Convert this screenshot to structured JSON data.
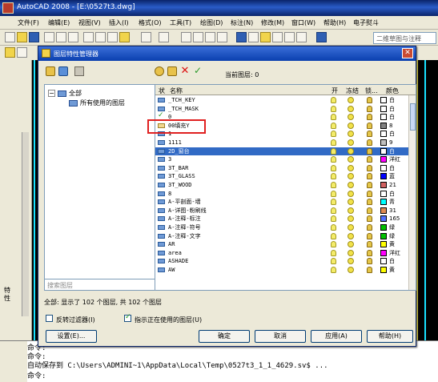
{
  "app": {
    "title": "AutoCAD 2008 - [E:\\0527t3.dwg]"
  },
  "menu": [
    "文件(F)",
    "编辑(E)",
    "视图(V)",
    "插入(I)",
    "格式(O)",
    "工具(T)",
    "绘图(D)",
    "标注(N)",
    "修改(M)",
    "窗口(W)",
    "帮助(H)",
    "电子熨斗"
  ],
  "workspace": {
    "value": "二维草图与注释"
  },
  "left_panel": {
    "vertical_tab": "特性"
  },
  "dialog": {
    "title": "图层特性管理器",
    "close_glyph": "✕",
    "current_layer": "当前图层: 0",
    "tree": {
      "all": "全部",
      "unused": "所有使用的图层"
    },
    "search_placeholder": "搜索图层",
    "columns": {
      "status": "状",
      "name": "名称",
      "on": "开",
      "freeze": "冻结",
      "lock": "锁...",
      "color": "颜色"
    },
    "status_text": "全部: 显示了 102 个图层, 共 102 个图层",
    "invert_filter": "反转过滤器(I)",
    "show_in_use": "指示正在使用的图层(U)",
    "buttons": {
      "settings": "设置(E)...",
      "ok": "确定",
      "cancel": "取消",
      "apply": "应用(A)",
      "help": "帮助(H)"
    }
  },
  "layers": [
    {
      "name": "_TCH_KEY",
      "color_name": "白",
      "color": "#ffffff",
      "state": "normal"
    },
    {
      "name": "_TCH_MASK",
      "color_name": "白",
      "color": "#ffffff",
      "state": "normal"
    },
    {
      "name": "0",
      "color_name": "白",
      "color": "#ffffff",
      "state": "current"
    },
    {
      "name": "00填充Y",
      "color_name": "8",
      "color": "#808080",
      "state": "unused"
    },
    {
      "name": "1",
      "color_name": "白",
      "color": "#ffffff",
      "state": "normal"
    },
    {
      "name": "1111",
      "color_name": "9",
      "color": "#c0c0c0",
      "state": "normal"
    },
    {
      "name": "2D_窗台",
      "color_name": "白",
      "color": "#ffffff",
      "state": "selected"
    },
    {
      "name": "3",
      "color_name": "洋红",
      "color": "#ff00ff",
      "state": "normal"
    },
    {
      "name": "3T_BAR",
      "color_name": "白",
      "color": "#ffffff",
      "state": "normal"
    },
    {
      "name": "3T_GLASS",
      "color_name": "蓝",
      "color": "#0000ff",
      "state": "normal"
    },
    {
      "name": "3T_WOOD",
      "color_name": "21",
      "color": "#d06060",
      "state": "normal"
    },
    {
      "name": "8",
      "color_name": "白",
      "color": "#ffffff",
      "state": "normal"
    },
    {
      "name": "A-平剖面-墙",
      "color_name": "青",
      "color": "#00ffff",
      "state": "normal"
    },
    {
      "name": "A-详图-粉刷线",
      "color_name": "31",
      "color": "#e08a50",
      "state": "normal"
    },
    {
      "name": "A-注释-标注",
      "color_name": "165",
      "color": "#5070ff",
      "state": "normal"
    },
    {
      "name": "A-注释-符号",
      "color_name": "绿",
      "color": "#00c000",
      "state": "normal"
    },
    {
      "name": "A-注释-文字",
      "color_name": "绿",
      "color": "#00c000",
      "state": "normal"
    },
    {
      "name": "AR",
      "color_name": "黄",
      "color": "#ffff00",
      "state": "normal"
    },
    {
      "name": "area",
      "color_name": "洋红",
      "color": "#ff00ff",
      "state": "normal"
    },
    {
      "name": "ASHADE",
      "color_name": "白",
      "color": "#ffffff",
      "state": "normal"
    },
    {
      "name": "AW",
      "color_name": "黄",
      "color": "#ffff00",
      "state": "normal"
    }
  ],
  "command_lines": [
    "命令:",
    "命令:",
    "自动保存到 C:\\Users\\ADMINI~1\\AppData\\Local\\Temp\\0527t3_1_1_4629.sv$ ...",
    "命令:"
  ]
}
